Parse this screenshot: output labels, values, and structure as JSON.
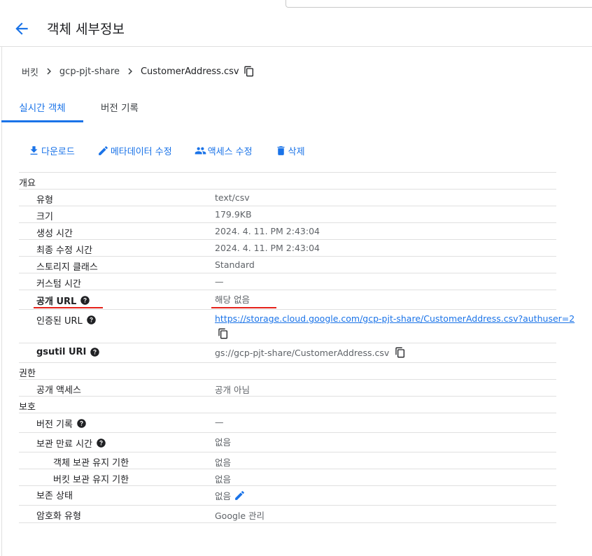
{
  "header": {
    "title": "객체 세부정보"
  },
  "breadcrumb": {
    "root": "버킷",
    "bucket": "gcp-pjt-share",
    "object": "CustomerAddress.csv"
  },
  "tabs": [
    {
      "label": "실시간 객체",
      "active": true
    },
    {
      "label": "버전 기록",
      "active": false
    }
  ],
  "actions": {
    "download": "다운로드",
    "edit_metadata": "메타데이터 수정",
    "edit_access": "액세스 수정",
    "delete": "삭제"
  },
  "sections": {
    "overview": "개요",
    "permissions": "권한",
    "protection": "보호"
  },
  "overview": {
    "type_label": "유형",
    "type_value": "text/csv",
    "size_label": "크기",
    "size_value": "179.9KB",
    "created_label": "생성 시간",
    "created_value": "2024. 4. 11. PM 2:43:04",
    "modified_label": "최종 수정 시간",
    "modified_value": "2024. 4. 11. PM 2:43:04",
    "storage_class_label": "스토리지 클래스",
    "storage_class_value": "Standard",
    "custom_time_label": "커스텀 시간",
    "custom_time_value": "—",
    "public_url_label": "공개 URL",
    "public_url_value": "해당 없음",
    "auth_url_label": "인증된 URL",
    "auth_url_value": "https://storage.cloud.google.com/gcp-pjt-share/CustomerAddress.csv?authuser=2",
    "gsutil_label": "gsutil URI",
    "gsutil_value": "gs://gcp-pjt-share/CustomerAddress.csv"
  },
  "permissions": {
    "public_access_label": "공개 액세스",
    "public_access_value": "공개 아님"
  },
  "protection": {
    "version_history_label": "버전 기록",
    "version_history_value": "—",
    "retention_label": "보관 만료 시간",
    "retention_value": "없음",
    "object_retention_label": "객체 보관 유지 기한",
    "object_retention_value": "없음",
    "bucket_retention_label": "버킷 보관 유지 기한",
    "bucket_retention_value": "없음",
    "hold_label": "보존 상태",
    "hold_value": "없음",
    "encryption_label": "암호화 유형",
    "encryption_value": "Google 관리"
  },
  "colors": {
    "accent": "#1a73e8",
    "annotation": "#e5221b"
  }
}
